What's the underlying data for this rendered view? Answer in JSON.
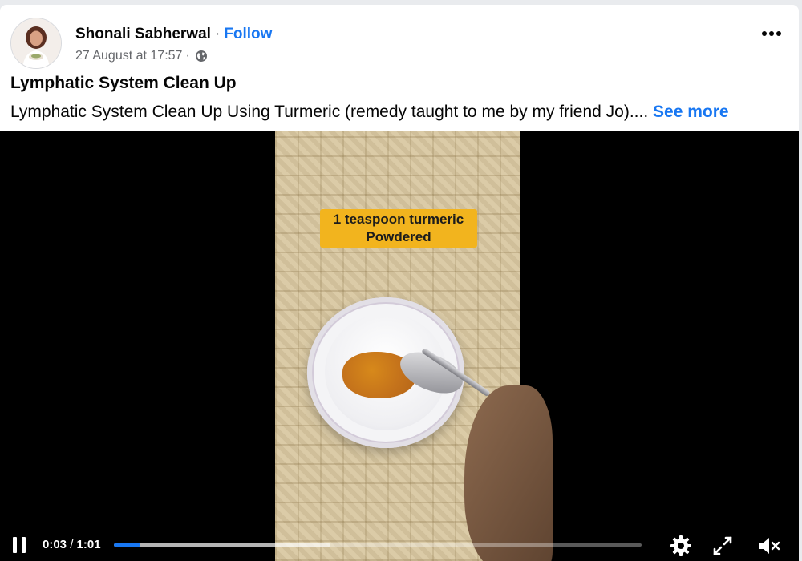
{
  "post": {
    "author_name": "Shonali Sabherwal",
    "separator": "·",
    "follow_label": "Follow",
    "timestamp": "27 August at 17:57",
    "meta_separator": "·",
    "privacy_icon": "globe-icon",
    "title": "Lymphatic System Clean Up",
    "body_text": "Lymphatic System Clean Up Using Turmeric (remedy taught to me by my friend Jo)....",
    "see_more_label": "See more",
    "menu_icon": "more-options-icon"
  },
  "video": {
    "caption_line1": "1 teaspoon turmeric",
    "caption_line2": "Powdered",
    "current_time": "0:03",
    "time_separator": "/",
    "duration": "1:01",
    "played_fraction": 0.05,
    "buffered_fraction": 0.41,
    "icons": {
      "pause": "pause-icon",
      "settings": "settings-gear-icon",
      "fullscreen": "fullscreen-icon",
      "mute": "volume-muted-icon"
    }
  },
  "colors": {
    "accent": "#1877f2",
    "caption_bg": "#f2b41e",
    "text": "#050505",
    "secondary_text": "#65676b"
  }
}
